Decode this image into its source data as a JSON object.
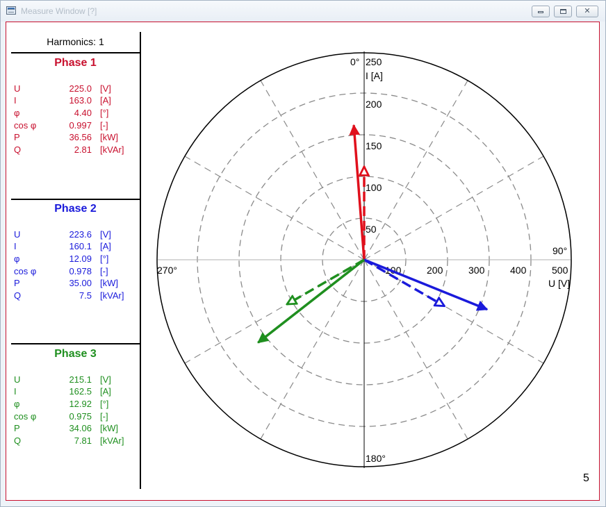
{
  "window": {
    "title": "Measure Window [?]",
    "colors": {
      "frame_border": "#c8102e",
      "phase1": "#c8102e",
      "phase2": "#1a1adb",
      "phase3": "#1f8f1f"
    }
  },
  "panel": {
    "harmonics": "Harmonics: 1",
    "phases": [
      {
        "title": "Phase 1",
        "rows": [
          {
            "label": "U",
            "value": "225.0",
            "unit": "[V]"
          },
          {
            "label": "I",
            "value": "163.0",
            "unit": "[A]"
          },
          {
            "label": "φ",
            "value": "4.40",
            "unit": "[°]"
          },
          {
            "label": "cos φ",
            "value": "0.997",
            "unit": "[-]"
          },
          {
            "label": "P",
            "value": "36.56",
            "unit": "[kW]"
          },
          {
            "label": "Q",
            "value": "2.81",
            "unit": "[kVAr]"
          }
        ]
      },
      {
        "title": "Phase 2",
        "rows": [
          {
            "label": "U",
            "value": "223.6",
            "unit": "[V]"
          },
          {
            "label": "I",
            "value": "160.1",
            "unit": "[A]"
          },
          {
            "label": "φ",
            "value": "12.09",
            "unit": "[°]"
          },
          {
            "label": "cos φ",
            "value": "0.978",
            "unit": "[-]"
          },
          {
            "label": "P",
            "value": "35.00",
            "unit": "[kW]"
          },
          {
            "label": "Q",
            "value": "7.5",
            "unit": "[kVAr]"
          }
        ]
      },
      {
        "title": "Phase 3",
        "rows": [
          {
            "label": "U",
            "value": "215.1",
            "unit": "[V]"
          },
          {
            "label": "I",
            "value": "162.5",
            "unit": "[A]"
          },
          {
            "label": "φ",
            "value": "12.92",
            "unit": "[°]"
          },
          {
            "label": "cos φ",
            "value": "0.975",
            "unit": "[-]"
          },
          {
            "label": "P",
            "value": "34.06",
            "unit": "[kW]"
          },
          {
            "label": "Q",
            "value": "7.81",
            "unit": "[kVAr]"
          }
        ]
      }
    ]
  },
  "phasor_diagram": {
    "angle_labels": {
      "top": "0°",
      "right": "90°",
      "bottom": "180°",
      "left": "270°"
    },
    "current_axis": {
      "ticks": [
        "50",
        "100",
        "150",
        "200",
        "250"
      ],
      "label": "I [A]",
      "max": 250
    },
    "voltage_axis": {
      "ticks": [
        "100",
        "200",
        "300",
        "400",
        "500"
      ],
      "label": "U [V]",
      "max": 500
    },
    "ring_count": 5,
    "spoke_step_deg": 30,
    "phasors": [
      {
        "phase": "Phase 1",
        "kind": "voltage",
        "style": "dashed",
        "color": "#e0101c",
        "magnitude": 225.0,
        "angle_deg": 0
      },
      {
        "phase": "Phase 1",
        "kind": "current",
        "style": "solid",
        "color": "#e0101c",
        "magnitude": 163.0,
        "angle_deg": -4.4
      },
      {
        "phase": "Phase 2",
        "kind": "voltage",
        "style": "dashed",
        "color": "#1a1adb",
        "magnitude": 223.6,
        "angle_deg": 120
      },
      {
        "phase": "Phase 2",
        "kind": "current",
        "style": "solid",
        "color": "#1a1adb",
        "magnitude": 160.1,
        "angle_deg": 112
      },
      {
        "phase": "Phase 3",
        "kind": "voltage",
        "style": "dashed",
        "color": "#1f8f1f",
        "magnitude": 215.1,
        "angle_deg": 240
      },
      {
        "phase": "Phase 3",
        "kind": "current",
        "style": "solid",
        "color": "#1f8f1f",
        "magnitude": 162.5,
        "angle_deg": 232
      }
    ]
  },
  "page_number": "5"
}
